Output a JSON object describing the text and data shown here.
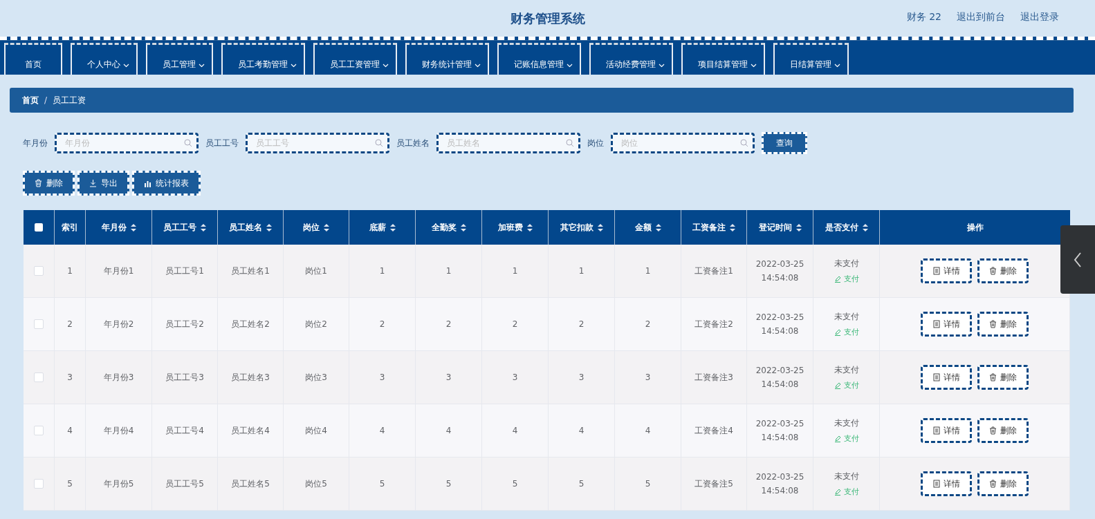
{
  "header": {
    "title": "财务管理系统",
    "user": "财务 22",
    "links": [
      "退出到前台",
      "退出登录"
    ]
  },
  "nav": [
    {
      "label": "首页",
      "dropdown": false
    },
    {
      "label": "个人中心",
      "dropdown": true
    },
    {
      "label": "员工管理",
      "dropdown": true
    },
    {
      "label": "员工考勤管理",
      "dropdown": true
    },
    {
      "label": "员工工资管理",
      "dropdown": true
    },
    {
      "label": "财务统计管理",
      "dropdown": true
    },
    {
      "label": "记账信息管理",
      "dropdown": true
    },
    {
      "label": "活动经费管理",
      "dropdown": true
    },
    {
      "label": "项目结算管理",
      "dropdown": true
    },
    {
      "label": "日结算管理",
      "dropdown": true
    }
  ],
  "breadcrumb": {
    "items": [
      "首页",
      "员工工资"
    ],
    "separator": "/"
  },
  "search": {
    "fields": [
      {
        "label": "年月份",
        "placeholder": "年月份"
      },
      {
        "label": "员工工号",
        "placeholder": "员工工号"
      },
      {
        "label": "员工姓名",
        "placeholder": "员工姓名"
      },
      {
        "label": "岗位",
        "placeholder": "岗位"
      }
    ],
    "button": "查询"
  },
  "actions": [
    {
      "kind": "delete",
      "label": "删除"
    },
    {
      "kind": "export",
      "label": "导出"
    },
    {
      "kind": "report",
      "label": "统计报表"
    }
  ],
  "table": {
    "all_checked": false,
    "columns": [
      {
        "label": "索引",
        "sortable": false
      },
      {
        "label": "年月份",
        "sortable": true
      },
      {
        "label": "员工工号",
        "sortable": true
      },
      {
        "label": "员工姓名",
        "sortable": true
      },
      {
        "label": "岗位",
        "sortable": true
      },
      {
        "label": "底薪",
        "sortable": true
      },
      {
        "label": "全勤奖",
        "sortable": true
      },
      {
        "label": "加班费",
        "sortable": true
      },
      {
        "label": "其它扣款",
        "sortable": true
      },
      {
        "label": "金额",
        "sortable": true
      },
      {
        "label": "工资备注",
        "sortable": true
      },
      {
        "label": "登记时间",
        "sortable": true
      },
      {
        "label": "是否支付",
        "sortable": true
      },
      {
        "label": "操作",
        "sortable": false
      }
    ],
    "rows": [
      {
        "selected": false,
        "cells": [
          "1",
          "年月份1",
          "员工工号1",
          "员工姓名1",
          "岗位1",
          "1",
          "1",
          "1",
          "1",
          "1",
          "工资备注1"
        ],
        "date": "2022-03-25",
        "time": "14:54:08",
        "status": "未支付",
        "pay": "支付",
        "actions": [
          "详情",
          "删除"
        ]
      },
      {
        "selected": false,
        "cells": [
          "2",
          "年月份2",
          "员工工号2",
          "员工姓名2",
          "岗位2",
          "2",
          "2",
          "2",
          "2",
          "2",
          "工资备注2"
        ],
        "date": "2022-03-25",
        "time": "14:54:08",
        "status": "未支付",
        "pay": "支付",
        "actions": [
          "详情",
          "删除"
        ]
      },
      {
        "selected": false,
        "cells": [
          "3",
          "年月份3",
          "员工工号3",
          "员工姓名3",
          "岗位3",
          "3",
          "3",
          "3",
          "3",
          "3",
          "工资备注3"
        ],
        "date": "2022-03-25",
        "time": "14:54:08",
        "status": "未支付",
        "pay": "支付",
        "actions": [
          "详情",
          "删除"
        ]
      },
      {
        "selected": false,
        "cells": [
          "4",
          "年月份4",
          "员工工号4",
          "员工姓名4",
          "岗位4",
          "4",
          "4",
          "4",
          "4",
          "4",
          "工资备注4"
        ],
        "date": "2022-03-25",
        "time": "14:54:08",
        "status": "未支付",
        "pay": "支付",
        "actions": [
          "详情",
          "删除"
        ]
      },
      {
        "selected": false,
        "cells": [
          "5",
          "年月份5",
          "员工工号5",
          "员工姓名5",
          "岗位5",
          "5",
          "5",
          "5",
          "5",
          "5",
          "工资备注5"
        ],
        "date": "2022-03-25",
        "time": "14:54:08",
        "status": "未支付",
        "pay": "支付",
        "actions": [
          "详情",
          "删除"
        ]
      }
    ]
  }
}
